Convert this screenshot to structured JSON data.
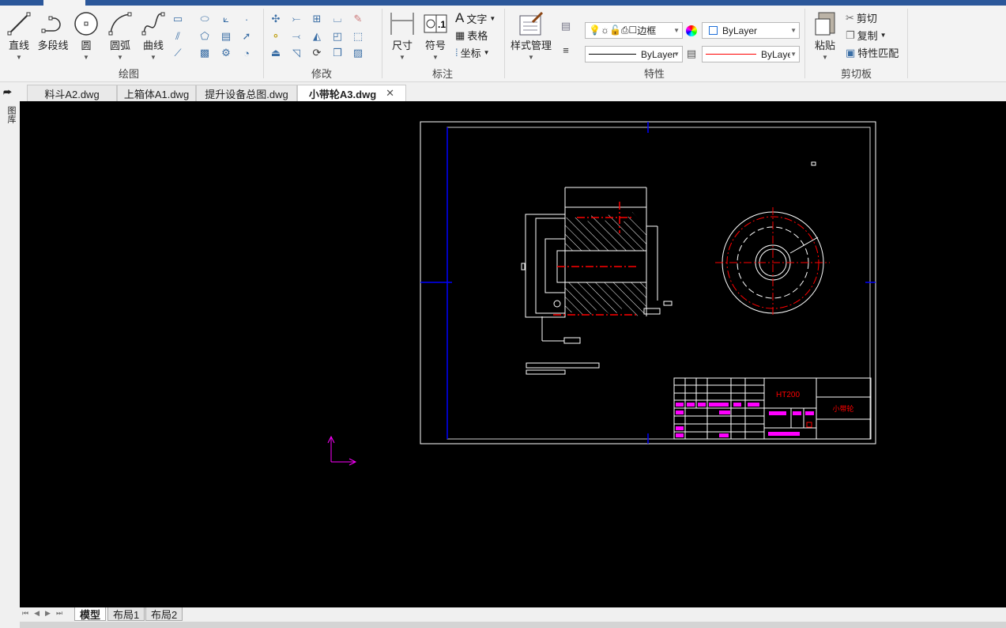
{
  "ribbon": {
    "groups": {
      "draw": "绘图",
      "modify": "修改",
      "annotate": "标注",
      "properties": "特性",
      "clipboard": "剪切板"
    },
    "draw": {
      "line": "直线",
      "polyline": "多段线",
      "circle": "圆",
      "arc": "圆弧",
      "spline": "曲线"
    },
    "annotate": {
      "dimension": "尺寸",
      "symbol": "符号",
      "text": "文字",
      "table": "表格",
      "coordinate": "坐标"
    },
    "properties": {
      "style_manager": "样式管理",
      "layer": "边框",
      "color": "ByLayer",
      "linetype": "ByLayer",
      "lineweight": "ByLayer",
      "lineweight_color": "#ff0000"
    },
    "clipboard": {
      "paste": "粘贴",
      "cut": "剪切",
      "copy": "复制",
      "match": "特性匹配"
    }
  },
  "file_tabs": [
    {
      "label": "料斗A2.dwg",
      "active": false
    },
    {
      "label": "上箱体A1.dwg",
      "active": false
    },
    {
      "label": "提升设备总图.dwg",
      "active": false
    },
    {
      "label": "小带轮A3.dwg",
      "active": true
    }
  ],
  "left_strip": {
    "label": "图库"
  },
  "drawing": {
    "material": "HT200",
    "part_name": "小带轮"
  },
  "layout_tabs": [
    {
      "label": "模型",
      "active": true
    },
    {
      "label": "布局1",
      "active": false
    },
    {
      "label": "布局2",
      "active": false
    }
  ],
  "colors": {
    "accent": "#2b579a",
    "canvas": "#000000",
    "dim_red": "#ff0000",
    "title_magenta": "#ff00ff",
    "center_blue": "#0000ff"
  }
}
